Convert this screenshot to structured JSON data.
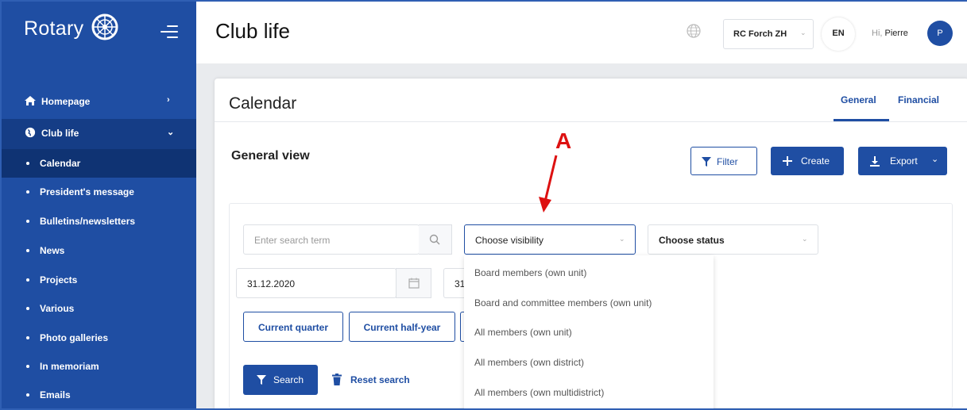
{
  "brand": {
    "name": "Rotary"
  },
  "sidebar": {
    "items": [
      {
        "label": "Homepage",
        "icon": "home-icon"
      },
      {
        "label": "Club life",
        "icon": "globe-icon"
      }
    ],
    "sub_items": [
      {
        "label": "Calendar",
        "active": true
      },
      {
        "label": "President's message"
      },
      {
        "label": "Bulletins/newsletters"
      },
      {
        "label": "News"
      },
      {
        "label": "Projects"
      },
      {
        "label": "Various"
      },
      {
        "label": "Photo galleries"
      },
      {
        "label": "In memoriam"
      },
      {
        "label": "Emails"
      }
    ]
  },
  "header": {
    "title": "Club life",
    "club_select": "RC Forch ZH",
    "language": "EN",
    "greeting_prefix": "Hi,",
    "user_name": "Pierre",
    "avatar_initial": "P"
  },
  "card": {
    "title": "Calendar",
    "tabs": [
      {
        "label": "General",
        "active": true
      },
      {
        "label": "Financial"
      }
    ],
    "section_title": "General view",
    "filter_label": "Filter",
    "create_label": "Create",
    "export_label": "Export"
  },
  "filters": {
    "search_placeholder": "Enter search term",
    "visibility_value": "Choose visibility",
    "status_value": "Choose status",
    "date_from": "31.12.2020",
    "date_to_partial": "31",
    "quick": [
      "Current quarter",
      "Current half-year"
    ],
    "search_label": "Search",
    "reset_label": "Reset search"
  },
  "visibility_options": [
    "Board members (own unit)",
    "Board and committee members (own unit)",
    "All members (own unit)",
    "All members (own district)",
    "All members (own multidistrict)"
  ],
  "annotation": {
    "label": "A",
    "color": "#dd1111"
  },
  "colors": {
    "primary": "#1f4ea3",
    "sidebar_active": "#0f3373"
  }
}
